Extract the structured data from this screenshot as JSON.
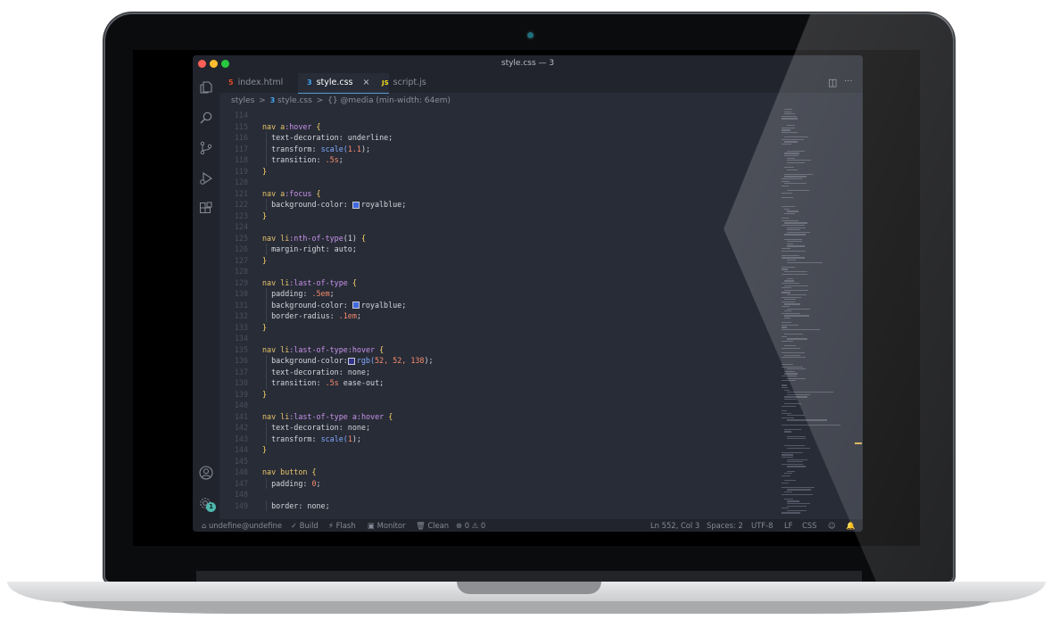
{
  "window": {
    "title": "style.css — 3"
  },
  "colors": {
    "traffic_red": "#ff5f57",
    "traffic_yellow": "#febc2e",
    "traffic_green": "#28c840",
    "accent": "#5a9bd5",
    "badge": "#4db6ac"
  },
  "activity_bar": {
    "top_icons": [
      "files-icon",
      "search-icon",
      "source-control-icon",
      "run-debug-icon",
      "extensions-icon"
    ],
    "bottom_icons": [
      "account-icon",
      "settings-icon"
    ],
    "settings_badge": "1"
  },
  "tabs": [
    {
      "icon": "html5-icon",
      "icon_text": "5",
      "label": "index.html",
      "active": false
    },
    {
      "icon": "css3-icon",
      "icon_text": "3",
      "label": "style.css",
      "active": true,
      "close": "×"
    },
    {
      "icon": "js-icon",
      "icon_text": "JS",
      "label": "script.js",
      "active": false
    }
  ],
  "tab_actions": {
    "split": "◫",
    "more": "···"
  },
  "breadcrumb": {
    "folder": "styles",
    "sep1": ">",
    "file": "style.css",
    "sep2": ">",
    "symbol": "{} @media (min-width: 64em)"
  },
  "code_lines": [
    {
      "n": "114",
      "text": ""
    },
    {
      "n": "115",
      "sel": "nav a",
      "pseudo": ":hover",
      "open": " {"
    },
    {
      "n": "116",
      "text": "  text-decoration: underline;"
    },
    {
      "n": "117",
      "prop": "  transform: ",
      "fn": "scale(",
      "num": "1.1",
      "end": ");"
    },
    {
      "n": "118",
      "prop": "  transition: ",
      "num": ".5s",
      "end": ";"
    },
    {
      "n": "119",
      "close": "}"
    },
    {
      "n": "120",
      "text": ""
    },
    {
      "n": "121",
      "sel": "nav a",
      "pseudo": ":focus",
      "open": " {"
    },
    {
      "n": "122",
      "prop": "  background-color: ",
      "swatch": "#4169e1",
      "val": "royalblue;"
    },
    {
      "n": "123",
      "close": "}"
    },
    {
      "n": "124",
      "text": ""
    },
    {
      "n": "125",
      "sel": "nav li",
      "pseudo": ":nth-of-type",
      "args": "(1)",
      "open": " {"
    },
    {
      "n": "126",
      "text": "  margin-right: auto;"
    },
    {
      "n": "127",
      "close": "}"
    },
    {
      "n": "128",
      "text": ""
    },
    {
      "n": "129",
      "sel": "nav li",
      "pseudo": ":last-of-type",
      "open": " {"
    },
    {
      "n": "130",
      "prop": "  padding: ",
      "num": ".5em",
      "end": ";"
    },
    {
      "n": "131",
      "prop": "  background-color: ",
      "swatch": "#4169e1",
      "val": "royalblue;"
    },
    {
      "n": "132",
      "prop": "  border-radius: ",
      "num": ".1em",
      "end": ";"
    },
    {
      "n": "133",
      "close": "}"
    },
    {
      "n": "134",
      "text": ""
    },
    {
      "n": "135",
      "sel": "nav li",
      "pseudo": ":last-of-type:hover",
      "open": " {"
    },
    {
      "n": "136",
      "prop": "  background-color:",
      "swatch": "#34348a",
      "fn": "rgb(",
      "num": "52, 52, 138",
      "end": ");"
    },
    {
      "n": "137",
      "text": "  text-decoration: none;"
    },
    {
      "n": "138",
      "prop": "  transition: ",
      "num": ".5s",
      "end": " ease-out;"
    },
    {
      "n": "139",
      "close": "}"
    },
    {
      "n": "140",
      "text": ""
    },
    {
      "n": "141",
      "sel": "nav li",
      "pseudo": ":last-of-type a:hover",
      "open": " {"
    },
    {
      "n": "142",
      "text": "  text-decoration: none;"
    },
    {
      "n": "143",
      "prop": "  transform: ",
      "fn": "scale(",
      "num": "1",
      "end": ");"
    },
    {
      "n": "144",
      "close": "}"
    },
    {
      "n": "145",
      "text": ""
    },
    {
      "n": "146",
      "sel": "nav button",
      "open": " {"
    },
    {
      "n": "147",
      "prop": "  padding: ",
      "num": "0",
      "end": ";"
    },
    {
      "n": "148",
      "text": ""
    },
    {
      "n": "149",
      "text": "  border: none;"
    }
  ],
  "statusbar": {
    "remote": "undefine@undefine",
    "build": "Build",
    "flash": "Flash",
    "monitor": "Monitor",
    "clean": "Clean",
    "errors": "0",
    "warnings": "0",
    "position": "Ln 552, Col 3",
    "spaces": "Spaces: 2",
    "encoding": "UTF-8",
    "eol": "LF",
    "language": "CSS"
  }
}
